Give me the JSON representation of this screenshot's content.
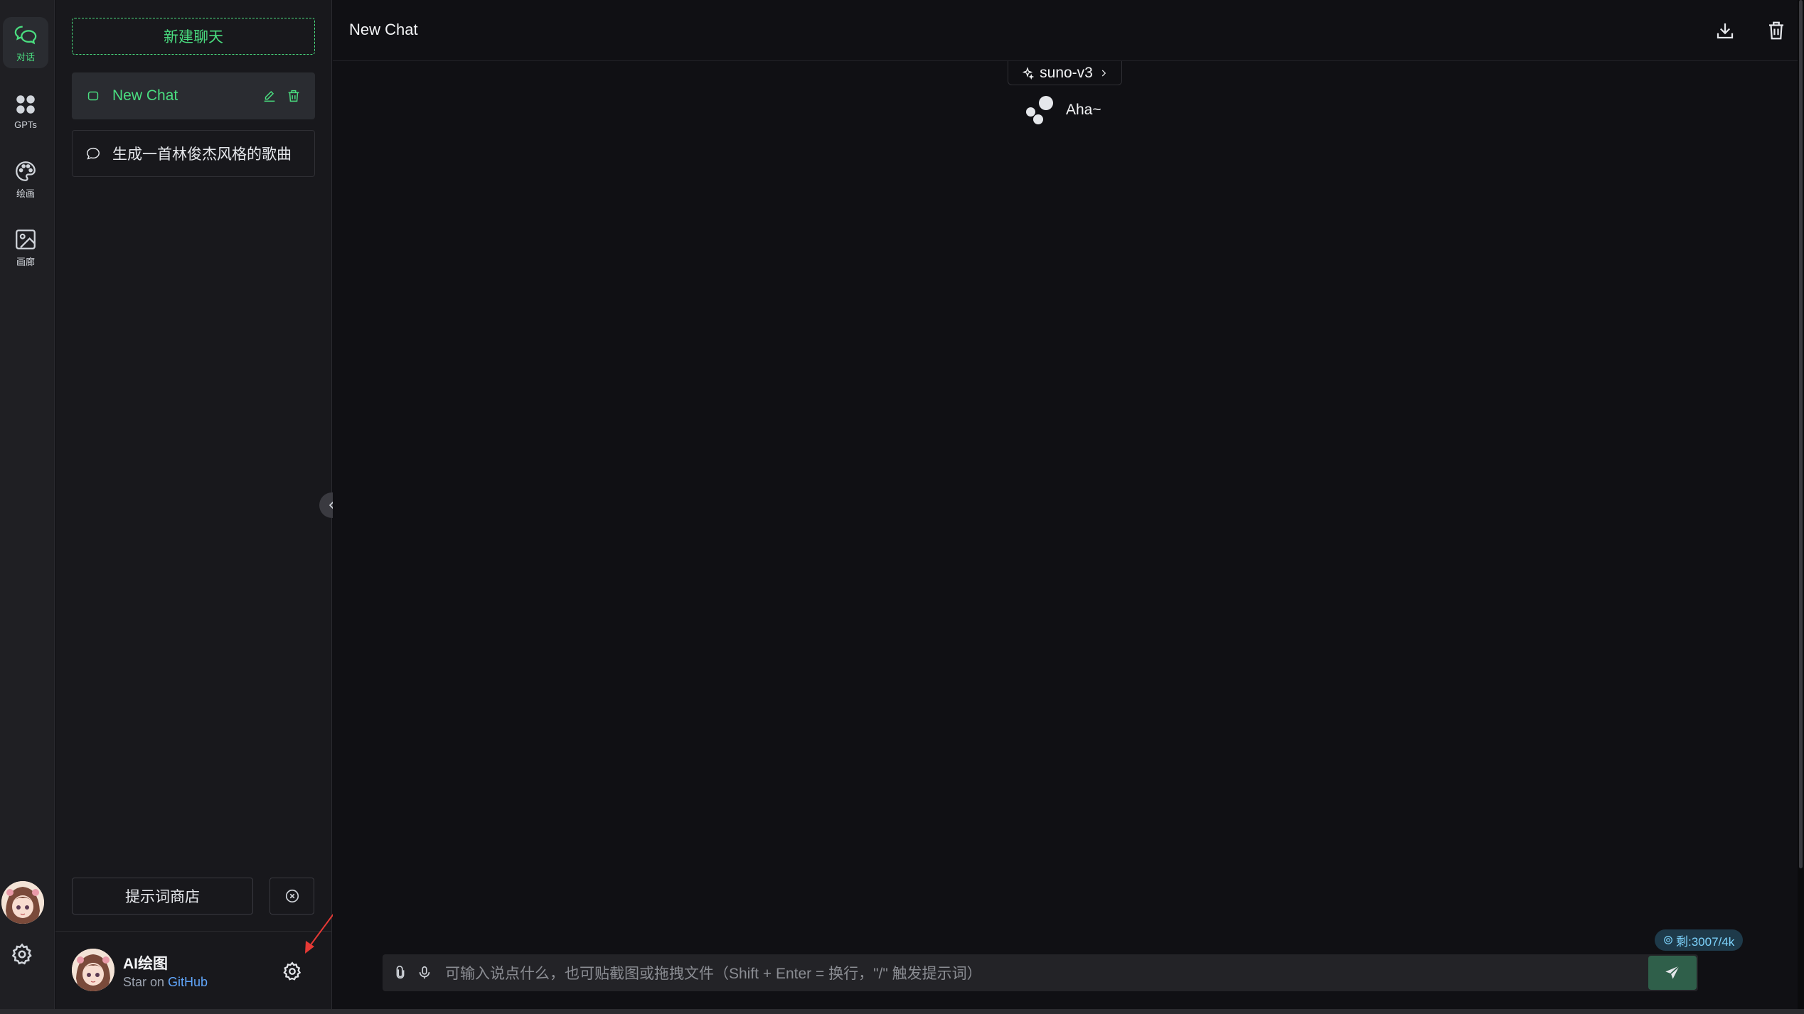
{
  "rail": {
    "items": [
      {
        "label": "对话",
        "icon": "chat-bubbles-icon",
        "active": true
      },
      {
        "label": "GPTs",
        "icon": "grid-icon",
        "active": false
      },
      {
        "label": "绘画",
        "icon": "palette-icon",
        "active": false
      },
      {
        "label": "画廊",
        "icon": "image-icon",
        "active": false
      }
    ]
  },
  "sidebar": {
    "new_chat_label": "新建聊天",
    "chats": [
      {
        "label": "New Chat",
        "active": true
      },
      {
        "label": "生成一首林俊杰风格的歌曲",
        "active": false
      }
    ],
    "prompt_store_label": "提示词商店",
    "user": {
      "name": "AI绘图",
      "sub_prefix": "Star on ",
      "sub_link": "GitHub"
    }
  },
  "main": {
    "title": "New Chat",
    "model": "suno-v3",
    "messages": [
      {
        "role": "assistant",
        "text": "Aha~"
      }
    ],
    "counter": "剩:3007/4k",
    "input_placeholder": "可输入说点什么，也可贴截图或拖拽文件（Shift + Enter = 换行，\"/\" 触发提示词）"
  },
  "colors": {
    "accent": "#4ade80",
    "background": "#101014",
    "sidebar_bg": "#18181c",
    "rail_bg": "#1f1f23",
    "send_bg": "#2f5f4a",
    "link": "#60a5fa"
  }
}
